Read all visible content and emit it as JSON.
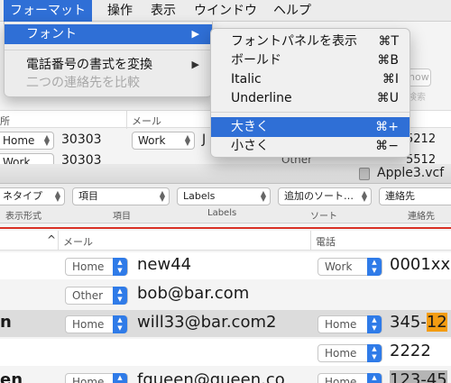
{
  "menubar": {
    "items": [
      {
        "label": "フォーマット",
        "active": true
      },
      {
        "label": "操作"
      },
      {
        "label": "表示"
      },
      {
        "label": "ウインドウ"
      },
      {
        "label": "ヘルプ"
      }
    ]
  },
  "format_menu": {
    "font": "フォント",
    "font_arrow": "▶",
    "phone_format": "電話番号の書式を変換",
    "phone_arrow": "▶",
    "compare": "二つの連絡先を比較"
  },
  "font_menu": {
    "items": [
      {
        "label": "フォントパネルを表示",
        "shortcut": "⌘T"
      },
      {
        "label": "ボールド",
        "shortcut": "⌘B"
      },
      {
        "label": "Italic",
        "shortcut": "⌘I"
      },
      {
        "label": "Underline",
        "shortcut": "⌘U"
      },
      {
        "label": "大きく",
        "shortcut": "⌘+",
        "selected": true
      },
      {
        "label": "小さく",
        "shortcut": "⌘−"
      }
    ]
  },
  "background": {
    "top_partial": {
      "how": "how",
      "search": "検索"
    },
    "upper_header": {
      "col1": "所",
      "col2": "メール"
    },
    "upper_row1": {
      "popup1": "Home",
      "value1": "30303",
      "popup2": "Work",
      "value2": "J",
      "value3": "5212"
    },
    "upper_row2": {
      "popup1": "Work",
      "value1": "30303",
      "label": "Other",
      "value2": "5512"
    },
    "file_title": "Apple3.vcf",
    "filters": {
      "f1": "ネタイプ",
      "f2": "項目",
      "f3": "Labels",
      "f4": "追加のソート…",
      "f5": "連絡先"
    },
    "filter_labels": {
      "l1": "表示形式",
      "l2": "項目",
      "l3": "Labels",
      "l4": "ソート",
      "l5": "連絡先"
    },
    "table_header": {
      "sort_arrow": "^",
      "mail": "メール",
      "phone": "電話"
    },
    "rows": [
      {
        "lead": "",
        "mail_label": "Home",
        "mail": "new44",
        "phone_label": "Work",
        "phone": "0001xx"
      },
      {
        "lead": "",
        "mail_label": "Other",
        "mail": "bob@bar.com",
        "phone_label": "",
        "phone": ""
      },
      {
        "lead": "n",
        "mail_label": "Home",
        "mail": "will33@bar.com2",
        "phone_label": "Home",
        "phone_a": "345-",
        "phone_b": "12"
      },
      {
        "lead": "",
        "mail_label": "",
        "mail": "",
        "phone_label": "Home",
        "phone": "2222"
      },
      {
        "lead": "en",
        "mail_label": "Home",
        "mail": "fqueen@queen.co",
        "phone_label": "Home",
        "phone": "123-45"
      }
    ]
  },
  "colors": {
    "accent": "#2f6fd6",
    "red_line": "#d93025",
    "orange_highlight": "#f39c12",
    "grey_highlight": "#9e9e9e",
    "stepper": "#2f7be8"
  }
}
